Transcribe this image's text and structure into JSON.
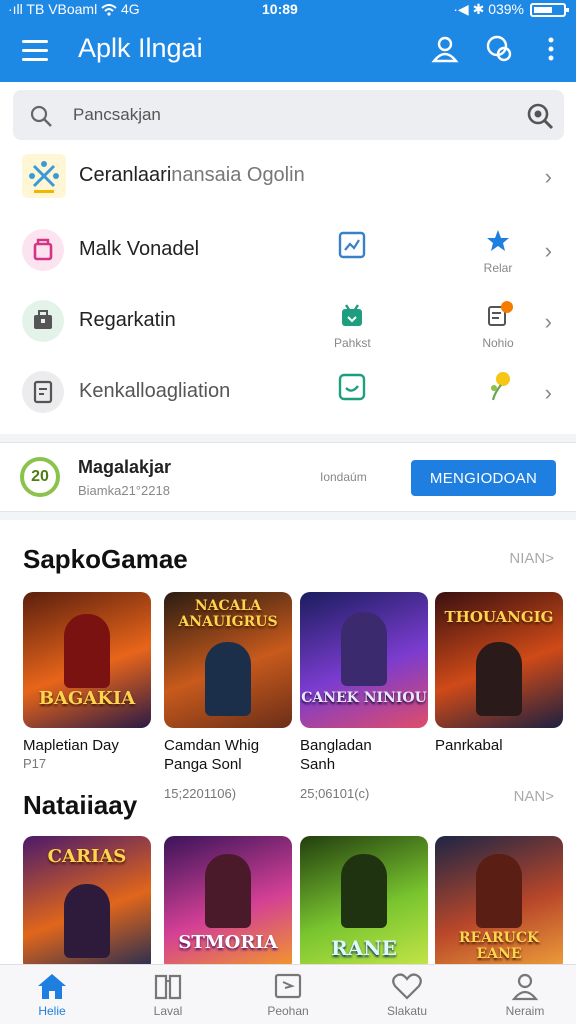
{
  "status_bar": {
    "left": "·ıll TB VBoaml",
    "network": "4G",
    "time": "10:89",
    "right": "·◀ ✱ 039%"
  },
  "header": {
    "title": "Aplk Ilngai"
  },
  "search": {
    "placeholder": "Pancsakjan"
  },
  "menu": {
    "rows": [
      {
        "label_main": "Ceranlaari",
        "label_faded": "nansaia Ogolin",
        "mid_caption": "",
        "right_caption": ""
      },
      {
        "label_main": "Malk Vonadel",
        "label_faded": "",
        "mid_caption": "",
        "right_caption": "Relar"
      },
      {
        "label_main": "Regarkatin",
        "label_faded": "",
        "mid_caption": "Pahkst",
        "right_caption": "Nohio"
      },
      {
        "label_main": "Kenkalloagliation",
        "label_faded": "",
        "mid_caption": "",
        "right_caption": ""
      }
    ]
  },
  "promo": {
    "badge": "20",
    "title": "Magalakjar",
    "subtitle": "Biamka21°2218",
    "note": "Iondaúm",
    "button": "MENGIODOAN"
  },
  "section1": {
    "title": "SapkoGamae",
    "more": "NIAN>",
    "cards": [
      {
        "art_text": "BAGAKIA",
        "name": "Mapletian Day",
        "sub": "P17",
        "colors": [
          "#5b1f0e",
          "#e8651a",
          "#2b1a45"
        ]
      },
      {
        "art_text": "NACALA ANAUIGRUS",
        "name": "Camdan Whig",
        "name2": "Panga Sonl",
        "colors": [
          "#2a1c12",
          "#c85a1c",
          "#6b2e18"
        ]
      },
      {
        "art_text": "CANEK NINIOU",
        "name": "Bangladan",
        "name2": "Sanh",
        "colors": [
          "#1b1d5e",
          "#7a3ccf",
          "#e04c6a"
        ]
      },
      {
        "art_text": "THOUANGIG",
        "name": "Panrkabal",
        "colors": [
          "#3a1010",
          "#cf4a18",
          "#1c2040"
        ]
      }
    ]
  },
  "section2": {
    "title": "Nataiiaay",
    "more": "NAN>",
    "meta": [
      "15;2201106)",
      "25;06101(c)"
    ],
    "cards": [
      {
        "art_text": "CARIAS",
        "colors": [
          "#4b1a6b",
          "#e0661b",
          "#1c2a55"
        ]
      },
      {
        "art_text": "STMORIA",
        "colors": [
          "#3a1459",
          "#d34095",
          "#f39c25"
        ]
      },
      {
        "art_text": "RANE",
        "colors": [
          "#233e0f",
          "#79c52f",
          "#c9e74a"
        ]
      },
      {
        "art_text": "REARUCK EANE",
        "colors": [
          "#1d2545",
          "#b8472a",
          "#f0a33a"
        ]
      }
    ]
  },
  "bottom_nav": {
    "items": [
      {
        "label": "Helie",
        "icon": "home-icon"
      },
      {
        "label": "Laval",
        "icon": "book-icon"
      },
      {
        "label": "Peohan",
        "icon": "flag-card-icon"
      },
      {
        "label": "Slakatu",
        "icon": "heart-icon"
      },
      {
        "label": "Neraim",
        "icon": "person-icon"
      }
    ]
  },
  "colors": {
    "accent": "#1e88e5",
    "button": "#1e7fe0",
    "promo_ring": "#8bc34a"
  }
}
